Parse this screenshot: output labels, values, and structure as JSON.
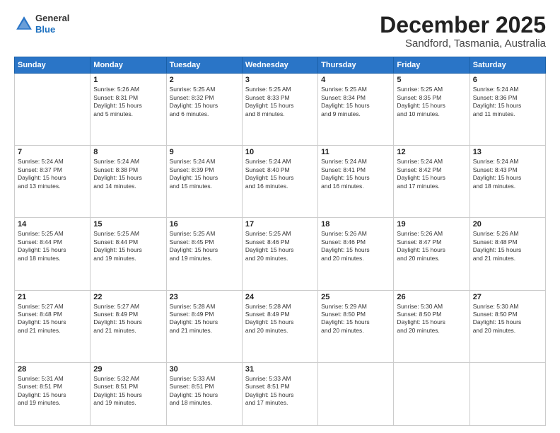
{
  "header": {
    "logo": {
      "general": "General",
      "blue": "Blue"
    },
    "title": "December 2025",
    "subtitle": "Sandford, Tasmania, Australia"
  },
  "calendar": {
    "days_of_week": [
      "Sunday",
      "Monday",
      "Tuesday",
      "Wednesday",
      "Thursday",
      "Friday",
      "Saturday"
    ],
    "weeks": [
      [
        {
          "day": "",
          "info": ""
        },
        {
          "day": "1",
          "info": "Sunrise: 5:26 AM\nSunset: 8:31 PM\nDaylight: 15 hours\nand 5 minutes."
        },
        {
          "day": "2",
          "info": "Sunrise: 5:25 AM\nSunset: 8:32 PM\nDaylight: 15 hours\nand 6 minutes."
        },
        {
          "day": "3",
          "info": "Sunrise: 5:25 AM\nSunset: 8:33 PM\nDaylight: 15 hours\nand 8 minutes."
        },
        {
          "day": "4",
          "info": "Sunrise: 5:25 AM\nSunset: 8:34 PM\nDaylight: 15 hours\nand 9 minutes."
        },
        {
          "day": "5",
          "info": "Sunrise: 5:25 AM\nSunset: 8:35 PM\nDaylight: 15 hours\nand 10 minutes."
        },
        {
          "day": "6",
          "info": "Sunrise: 5:24 AM\nSunset: 8:36 PM\nDaylight: 15 hours\nand 11 minutes."
        }
      ],
      [
        {
          "day": "7",
          "info": "Sunrise: 5:24 AM\nSunset: 8:37 PM\nDaylight: 15 hours\nand 13 minutes."
        },
        {
          "day": "8",
          "info": "Sunrise: 5:24 AM\nSunset: 8:38 PM\nDaylight: 15 hours\nand 14 minutes."
        },
        {
          "day": "9",
          "info": "Sunrise: 5:24 AM\nSunset: 8:39 PM\nDaylight: 15 hours\nand 15 minutes."
        },
        {
          "day": "10",
          "info": "Sunrise: 5:24 AM\nSunset: 8:40 PM\nDaylight: 15 hours\nand 16 minutes."
        },
        {
          "day": "11",
          "info": "Sunrise: 5:24 AM\nSunset: 8:41 PM\nDaylight: 15 hours\nand 16 minutes."
        },
        {
          "day": "12",
          "info": "Sunrise: 5:24 AM\nSunset: 8:42 PM\nDaylight: 15 hours\nand 17 minutes."
        },
        {
          "day": "13",
          "info": "Sunrise: 5:24 AM\nSunset: 8:43 PM\nDaylight: 15 hours\nand 18 minutes."
        }
      ],
      [
        {
          "day": "14",
          "info": "Sunrise: 5:25 AM\nSunset: 8:44 PM\nDaylight: 15 hours\nand 18 minutes."
        },
        {
          "day": "15",
          "info": "Sunrise: 5:25 AM\nSunset: 8:44 PM\nDaylight: 15 hours\nand 19 minutes."
        },
        {
          "day": "16",
          "info": "Sunrise: 5:25 AM\nSunset: 8:45 PM\nDaylight: 15 hours\nand 19 minutes."
        },
        {
          "day": "17",
          "info": "Sunrise: 5:25 AM\nSunset: 8:46 PM\nDaylight: 15 hours\nand 20 minutes."
        },
        {
          "day": "18",
          "info": "Sunrise: 5:26 AM\nSunset: 8:46 PM\nDaylight: 15 hours\nand 20 minutes."
        },
        {
          "day": "19",
          "info": "Sunrise: 5:26 AM\nSunset: 8:47 PM\nDaylight: 15 hours\nand 20 minutes."
        },
        {
          "day": "20",
          "info": "Sunrise: 5:26 AM\nSunset: 8:48 PM\nDaylight: 15 hours\nand 21 minutes."
        }
      ],
      [
        {
          "day": "21",
          "info": "Sunrise: 5:27 AM\nSunset: 8:48 PM\nDaylight: 15 hours\nand 21 minutes."
        },
        {
          "day": "22",
          "info": "Sunrise: 5:27 AM\nSunset: 8:49 PM\nDaylight: 15 hours\nand 21 minutes."
        },
        {
          "day": "23",
          "info": "Sunrise: 5:28 AM\nSunset: 8:49 PM\nDaylight: 15 hours\nand 21 minutes."
        },
        {
          "day": "24",
          "info": "Sunrise: 5:28 AM\nSunset: 8:49 PM\nDaylight: 15 hours\nand 20 minutes."
        },
        {
          "day": "25",
          "info": "Sunrise: 5:29 AM\nSunset: 8:50 PM\nDaylight: 15 hours\nand 20 minutes."
        },
        {
          "day": "26",
          "info": "Sunrise: 5:30 AM\nSunset: 8:50 PM\nDaylight: 15 hours\nand 20 minutes."
        },
        {
          "day": "27",
          "info": "Sunrise: 5:30 AM\nSunset: 8:50 PM\nDaylight: 15 hours\nand 20 minutes."
        }
      ],
      [
        {
          "day": "28",
          "info": "Sunrise: 5:31 AM\nSunset: 8:51 PM\nDaylight: 15 hours\nand 19 minutes."
        },
        {
          "day": "29",
          "info": "Sunrise: 5:32 AM\nSunset: 8:51 PM\nDaylight: 15 hours\nand 19 minutes."
        },
        {
          "day": "30",
          "info": "Sunrise: 5:33 AM\nSunset: 8:51 PM\nDaylight: 15 hours\nand 18 minutes."
        },
        {
          "day": "31",
          "info": "Sunrise: 5:33 AM\nSunset: 8:51 PM\nDaylight: 15 hours\nand 17 minutes."
        },
        {
          "day": "",
          "info": ""
        },
        {
          "day": "",
          "info": ""
        },
        {
          "day": "",
          "info": ""
        }
      ]
    ]
  }
}
